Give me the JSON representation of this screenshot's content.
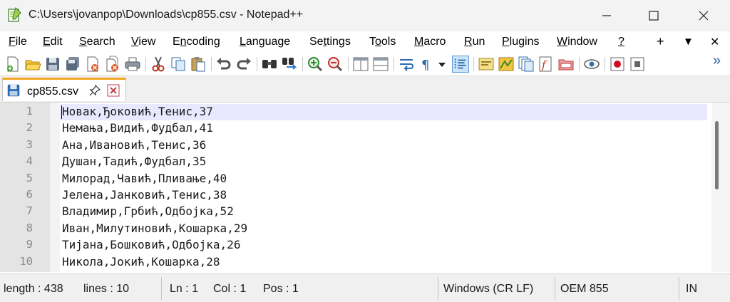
{
  "window": {
    "title": "C:\\Users\\jovanpop\\Downloads\\cp855.csv - Notepad++",
    "icons": {
      "app": "notepadpp-icon",
      "minimize": "minimize-icon",
      "maximize": "maximize-icon",
      "close": "close-icon"
    }
  },
  "menu": {
    "items": [
      {
        "pre": "",
        "u": "F",
        "post": "ile"
      },
      {
        "pre": "",
        "u": "E",
        "post": "dit"
      },
      {
        "pre": "",
        "u": "S",
        "post": "earch"
      },
      {
        "pre": "",
        "u": "V",
        "post": "iew"
      },
      {
        "pre": "E",
        "u": "n",
        "post": "coding"
      },
      {
        "pre": "",
        "u": "L",
        "post": "anguage"
      },
      {
        "pre": "Se",
        "u": "t",
        "post": "tings"
      },
      {
        "pre": "T",
        "u": "o",
        "post": "ols"
      },
      {
        "pre": "",
        "u": "M",
        "post": "acro"
      },
      {
        "pre": "",
        "u": "R",
        "post": "un"
      },
      {
        "pre": "",
        "u": "P",
        "post": "lugins"
      },
      {
        "pre": "",
        "u": "W",
        "post": "indow"
      },
      {
        "pre": "",
        "u": "?",
        "post": ""
      }
    ],
    "right": {
      "plus": "+",
      "dropdown": "▼",
      "close": "✕"
    }
  },
  "toolbar": {
    "icons": [
      "new-file-icon",
      "open-file-icon",
      "save-icon",
      "save-all-icon",
      "close-icon",
      "close-all-icon",
      "print-icon",
      "cut-icon",
      "copy-icon",
      "paste-icon",
      "undo-icon",
      "redo-icon",
      "find-icon",
      "replace-icon",
      "zoom-in-icon",
      "zoom-out-icon",
      "sync-vertical-icon",
      "sync-horizontal-icon",
      "word-wrap-icon",
      "show-all-characters-icon",
      "indent-guide-icon",
      "user-defined-language-icon",
      "document-map-icon",
      "document-list-icon",
      "function-list-icon",
      "folder-as-workspace-icon",
      "monitoring-icon",
      "record-macro-icon",
      "stop-record-icon"
    ],
    "overflow": "»"
  },
  "tab": {
    "label": "cp855.csv",
    "pin": "pin-icon",
    "close": "close-tab-icon"
  },
  "editor": {
    "lines": [
      {
        "no": "1",
        "text": "Новак,Ђоковић,Тенис,37"
      },
      {
        "no": "2",
        "text": "Немања,Видић,Фудбал,41"
      },
      {
        "no": "3",
        "text": "Ана,Ивановић,Тенис,36"
      },
      {
        "no": "4",
        "text": "Душан,Тадић,Фудбал,35"
      },
      {
        "no": "5",
        "text": "Милорад,Чавић,Пливање,40"
      },
      {
        "no": "6",
        "text": "Јелена,Јанковић,Тенис,38"
      },
      {
        "no": "7",
        "text": "Владимир,Грбић,Одбојка,52"
      },
      {
        "no": "8",
        "text": "Иван,Милутиновић,Кошарка,29"
      },
      {
        "no": "9",
        "text": "Тијана,Бошковић,Одбојка,26"
      },
      {
        "no": "10",
        "text": "Никола,Јокић,Кошарка,28"
      }
    ]
  },
  "status": {
    "length": "length : 438",
    "lines": "lines : 10",
    "ln": "Ln : 1",
    "col": "Col : 1",
    "pos": "Pos : 1",
    "eol": "Windows (CR LF)",
    "encoding": "OEM 855",
    "mode": "IN"
  },
  "colors": {
    "tab_accent": "#f5a623",
    "current_line": "#e8e8ff",
    "gutter": "#e4e4e4"
  }
}
